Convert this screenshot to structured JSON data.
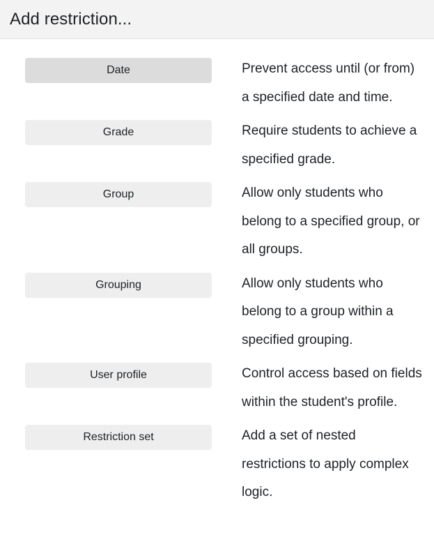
{
  "header": {
    "title": "Add restriction..."
  },
  "options": [
    {
      "label": "Date",
      "description": "Prevent access until (or from) a specified date and time.",
      "state": "hovered"
    },
    {
      "label": "Grade",
      "description": "Require students to achieve a specified grade.",
      "state": "normal"
    },
    {
      "label": "Group",
      "description": "Allow only students who belong to a specified group, or all groups.",
      "state": "normal"
    },
    {
      "label": "Grouping",
      "description": "Allow only students who belong to a group within a specified grouping.",
      "state": "normal"
    },
    {
      "label": "User profile",
      "description": "Control access based on fields within the student's profile.",
      "state": "normal"
    },
    {
      "label": "Restriction set",
      "description": "Add a set of nested restrictions to apply complex logic.",
      "state": "normal"
    }
  ],
  "colors": {
    "header_background": "#f3f3f3",
    "header_border": "#e3e3e3",
    "button_background": "#eeeeee",
    "button_background_hovered": "#dcdcdc",
    "text": "#1d2125",
    "page_background": "#ffffff"
  }
}
